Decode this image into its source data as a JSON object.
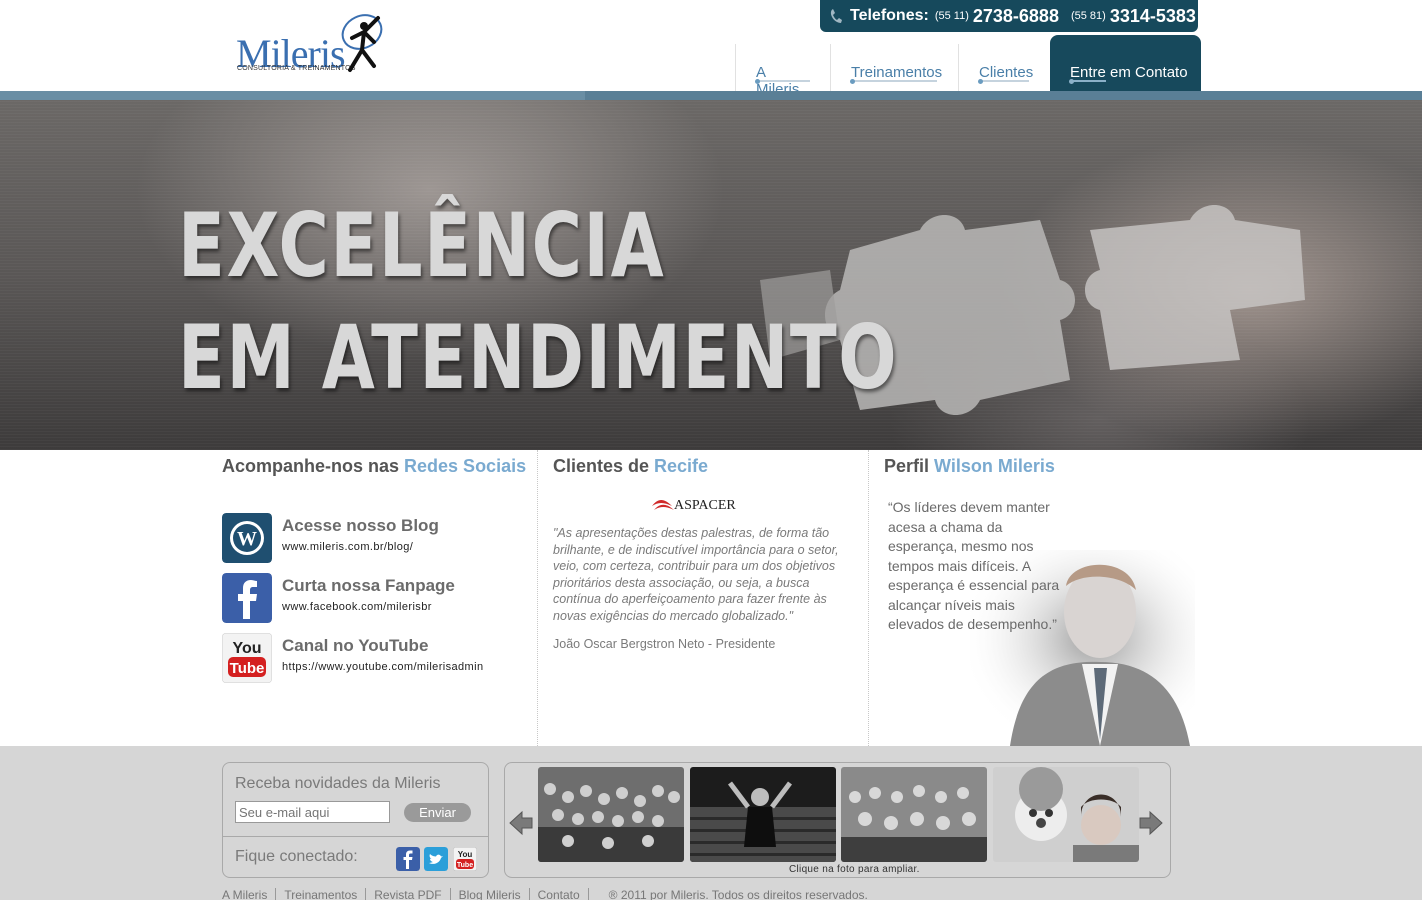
{
  "brand": {
    "name": "Mileris",
    "tagline": "CONSULTORIA & TREINAMENTOS"
  },
  "phones": {
    "label": "Telefones:",
    "phone1_area": "(55 11)",
    "phone1_number": "2738-6888",
    "phone2_area": "(55 81)",
    "phone2_number": "3314-5383"
  },
  "nav": {
    "items": [
      {
        "label": "A Mileris"
      },
      {
        "label": "Treinamentos"
      },
      {
        "label": "Clientes"
      },
      {
        "label": "Entre em Contato"
      }
    ]
  },
  "hero": {
    "line1": "EXCELÊNCIA",
    "line2": "EM ATENDIMENTO"
  },
  "social": {
    "title_plain": "Acompanhe-nos nas ",
    "title_highlight": "Redes Sociais",
    "items": [
      {
        "icon": "wordpress-icon",
        "title": "Acesse nosso Blog",
        "url": "www.mileris.com.br/blog/"
      },
      {
        "icon": "facebook-icon",
        "title": "Curta nossa Fanpage",
        "url": "www.facebook.com/milerisbr"
      },
      {
        "icon": "youtube-icon",
        "title": "Canal no YouTube",
        "url": "https://www.youtube.com/milerisadmin"
      }
    ]
  },
  "clients": {
    "title_plain": "Clientes de ",
    "title_highlight": "Recife",
    "logo_text": "ASPACER",
    "quote": "\"As apresentações destas palestras, de forma tão brilhante, e de indiscutível importância para o setor, veio, com certeza, contribuir para um dos objetivos prioritários desta associação, ou seja, a busca contínua do aperfeiçoamento para fazer frente às novas exigências do mercado globalizado.\"",
    "author": "João Oscar Bergstron Neto - Presidente"
  },
  "profile": {
    "title_plain": "Perfil ",
    "title_highlight": "Wilson Mileris",
    "quote": "“Os líderes devem manter acesa a chama da esperança, mesmo nos tempos mais difíceis. A esperança é essencial para alcançar níveis mais elevados de desempenho.”"
  },
  "newsletter": {
    "title": "Receba novidades da Mileris",
    "placeholder": "Seu e-mail aqui",
    "button": "Enviar",
    "connected": "Fique conectado:"
  },
  "gallery": {
    "caption": "Clique na foto para ampliar."
  },
  "footer": {
    "links": [
      "A Mileris",
      "Treinamentos",
      "Revista PDF",
      "Blog Mileris",
      "Contato"
    ],
    "copyright": "® 2011 por Mileris. Todos os direitos reservados."
  },
  "colors": {
    "brand_blue": "#16495c",
    "accent_blue": "#7aaad0",
    "nav_text": "#4a7fa8"
  }
}
